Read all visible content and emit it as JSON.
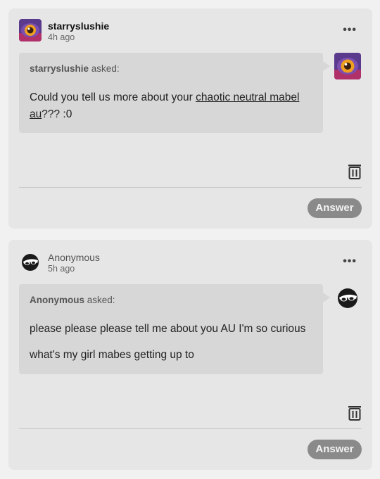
{
  "posts": [
    {
      "author": "starryslushie",
      "time": "4h ago",
      "more_label": "•••",
      "asker": "starryslushie",
      "asked_label": " asked:",
      "question_prefix": "Could you tell us more about your ",
      "question_link": "chaotic neutral mabel au",
      "question_suffix": "??? :0",
      "avatar_icon": "purple-eye-avatar-icon",
      "answer_label": "Answer"
    },
    {
      "author": "Anonymous",
      "time": "5h ago",
      "more_label": "•••",
      "asker": "Anonymous",
      "asked_label": " asked:",
      "question_line1": "please please please tell me about you AU I'm so curious",
      "question_line2": "what's my girl mabes getting up to",
      "avatar_icon": "sunglasses-avatar-icon",
      "answer_label": "Answer"
    }
  ],
  "colors": {
    "card_bg": "#e6e6e6",
    "bubble_bg": "#d7d7d7",
    "answer_button_bg": "#8a8a8a"
  }
}
